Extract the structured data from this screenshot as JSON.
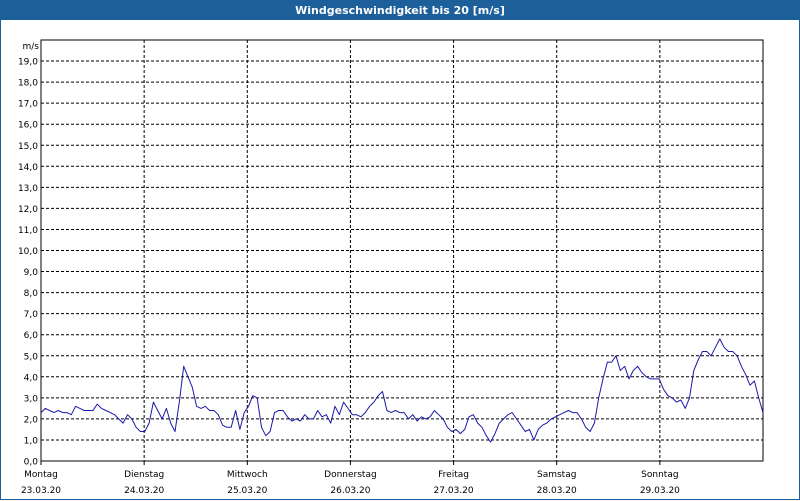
{
  "title": "Windgeschwindigkeit bis 20 [m/s]",
  "chart_data": {
    "type": "line",
    "title": "Windgeschwindigkeit bis 20 [m/s]",
    "ylabel": "m/s",
    "xlabel": "",
    "ylim": [
      0,
      20
    ],
    "xlim": [
      0,
      7
    ],
    "grid": true,
    "line_color": "#1a1aa6",
    "y_ticks": [
      "0,0",
      "1,0",
      "2,0",
      "3,0",
      "4,0",
      "5,0",
      "6,0",
      "7,0",
      "8,0",
      "9,0",
      "10,0",
      "11,0",
      "12,0",
      "13,0",
      "14,0",
      "15,0",
      "16,0",
      "17,0",
      "18,0",
      "19,0"
    ],
    "x_categories": [
      {
        "day": "Montag",
        "date": "23.03.20"
      },
      {
        "day": "Dienstag",
        "date": "24.03.20"
      },
      {
        "day": "Mittwoch",
        "date": "25.03.20"
      },
      {
        "day": "Donnerstag",
        "date": "26.03.20"
      },
      {
        "day": "Freitag",
        "date": "27.03.20"
      },
      {
        "day": "Samstag",
        "date": "28.03.20"
      },
      {
        "day": "Sonntag",
        "date": "29.03.20"
      }
    ],
    "series": [
      {
        "values": [
          2.3,
          2.5,
          2.4,
          2.3,
          2.4,
          2.3,
          2.3,
          2.2,
          2.6,
          2.5,
          2.4,
          2.4,
          2.4,
          2.7,
          2.5,
          2.4,
          2.3,
          2.2,
          2.0,
          1.8,
          2.2,
          2.0,
          1.6,
          1.4,
          1.4,
          1.8,
          2.8,
          2.4,
          2.0,
          2.5,
          1.8,
          1.4,
          2.8,
          4.5,
          4.0,
          3.5,
          2.6,
          2.5,
          2.6,
          2.4,
          2.4,
          2.2,
          1.7,
          1.6,
          1.6,
          2.4,
          1.5,
          2.3,
          2.6,
          3.1,
          3.0,
          1.6,
          1.2,
          1.4,
          2.3,
          2.4,
          2.4,
          2.1,
          1.9,
          2.0,
          1.9,
          2.2,
          2.0,
          2.0,
          2.4,
          2.1,
          2.2,
          1.8,
          2.6,
          2.2,
          2.8,
          2.5,
          2.2,
          2.2,
          2.1,
          2.3,
          2.6,
          2.8,
          3.1,
          3.3,
          2.4,
          2.3,
          2.4,
          2.3,
          2.3,
          2.0,
          2.2,
          1.9,
          2.1,
          2.0,
          2.1,
          2.4,
          2.2,
          2.0,
          1.6,
          1.4,
          1.5,
          1.3,
          1.5,
          2.1,
          2.2,
          1.8,
          1.6,
          1.2,
          0.9,
          1.3,
          1.8,
          2.0,
          2.2,
          2.3,
          2.0,
          1.7,
          1.4,
          1.5,
          1.0,
          1.5,
          1.7,
          1.8,
          2.0,
          2.1,
          2.2,
          2.3,
          2.4,
          2.3,
          2.3,
          2.0,
          1.6,
          1.4,
          1.8,
          3.0,
          3.9,
          4.7,
          4.7,
          5.0,
          4.3,
          4.5,
          3.9,
          4.3,
          4.5,
          4.2,
          4.0,
          3.9,
          3.9,
          3.9,
          3.4,
          3.1,
          3.0,
          2.8,
          2.9,
          2.5,
          3.0,
          4.3,
          4.8,
          5.2,
          5.2,
          5.0,
          5.4,
          5.8,
          5.4,
          5.2,
          5.2,
          5.0,
          4.5,
          4.1,
          3.6,
          3.8,
          3.0,
          2.3
        ]
      }
    ]
  }
}
